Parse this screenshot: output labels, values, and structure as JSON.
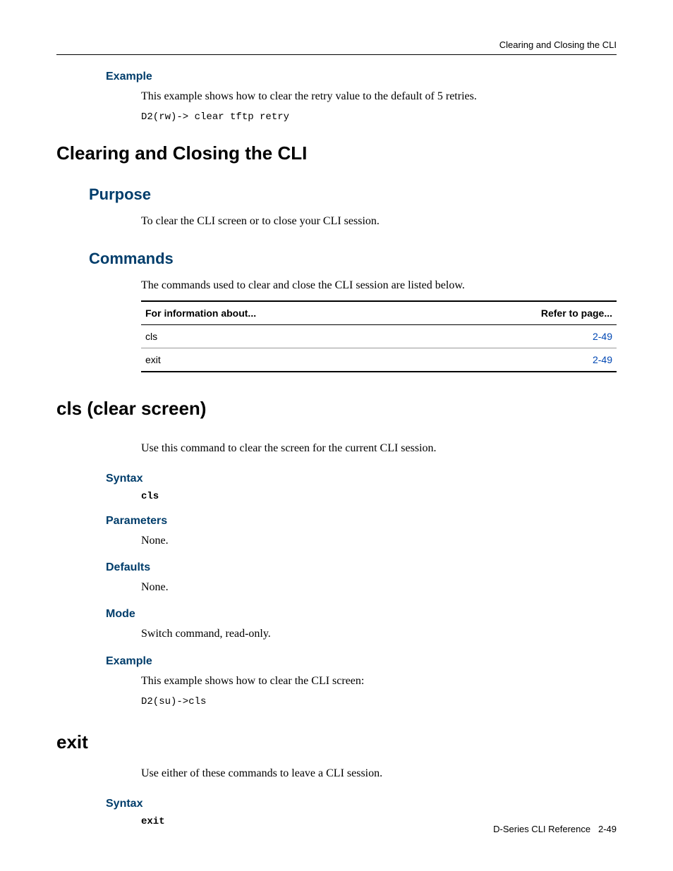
{
  "header": {
    "running_title": "Clearing and Closing the CLI"
  },
  "intro": {
    "example_heading": "Example",
    "example_text": "This example shows how to clear the retry value to the default of 5 retries.",
    "example_code": "D2(rw)-> clear tftp retry"
  },
  "section1": {
    "title": "Clearing and Closing the CLI",
    "purpose_heading": "Purpose",
    "purpose_text": "To clear the CLI screen or to close your CLI session.",
    "commands_heading": "Commands",
    "commands_text": "The commands used to clear and close the CLI session are listed below.",
    "table": {
      "col1": "For information about...",
      "col2": "Refer to page...",
      "rows": [
        {
          "cmd": "cls",
          "page": "2-49"
        },
        {
          "cmd": "exit",
          "page": "2-49"
        }
      ]
    }
  },
  "cls": {
    "title": "cls (clear screen)",
    "intro": "Use this command to clear the screen for the current CLI session.",
    "syntax_heading": "Syntax",
    "syntax_code": "cls",
    "parameters_heading": "Parameters",
    "parameters_text": "None.",
    "defaults_heading": "Defaults",
    "defaults_text": "None.",
    "mode_heading": "Mode",
    "mode_text": "Switch command, read-only.",
    "example_heading": "Example",
    "example_text": "This example shows how to clear the CLI screen:",
    "example_code": "D2(su)->cls"
  },
  "exit": {
    "title": "exit",
    "intro": "Use either of these commands to leave a CLI session.",
    "syntax_heading": "Syntax",
    "syntax_code": "exit"
  },
  "footer": {
    "doc": "D-Series CLI Reference",
    "page": "2-49"
  }
}
